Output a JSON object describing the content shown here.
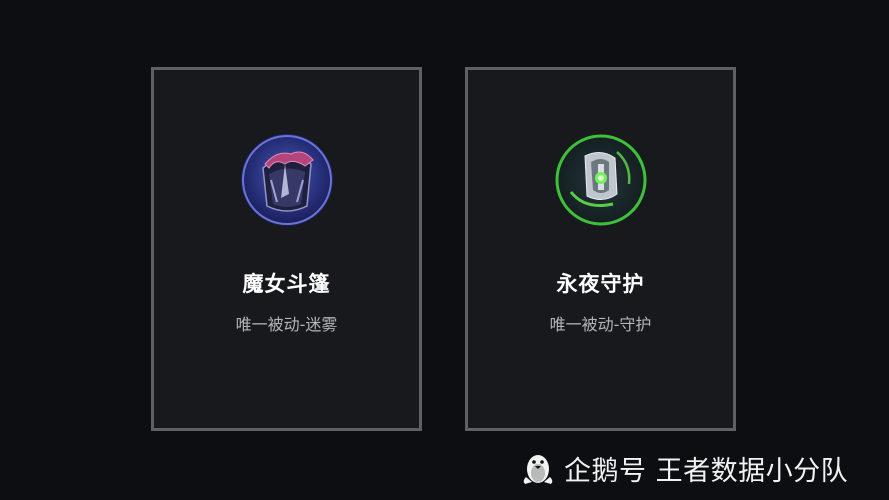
{
  "items": [
    {
      "name": "魔女斗篷",
      "description": "唯一被动-迷雾",
      "icon": "purple-cloak-icon",
      "accent": "#3d3f9e"
    },
    {
      "name": "永夜守护",
      "description": "唯一被动-守护",
      "icon": "green-armor-icon",
      "accent": "#3fbf3a"
    }
  ],
  "watermark": {
    "icon": "penguin-icon",
    "text": "企鹅号 王者数据小分队"
  }
}
